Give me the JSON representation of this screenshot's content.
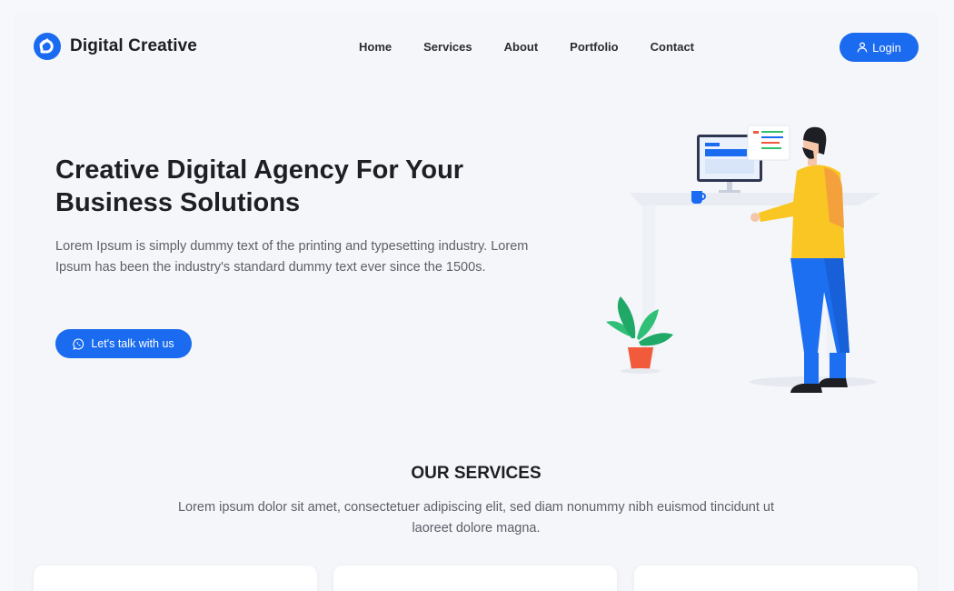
{
  "brand": {
    "name": "Digital Creative",
    "logo_icon": "d-logo-icon",
    "accent": "#1a6bf0"
  },
  "nav": {
    "items": [
      "Home",
      "Services",
      "About",
      "Portfolio",
      "Contact"
    ]
  },
  "header": {
    "login_label": "Login",
    "login_icon": "user-icon"
  },
  "hero": {
    "title": "Creative Digital Agency For Your Business Solutions",
    "text": "Lorem Ipsum is simply dummy text of the printing and typesetting industry. Lorem Ipsum has been the industry's standard dummy text ever since the 1500s.",
    "cta_label": "Let's talk with us",
    "cta_icon": "whatsapp-icon"
  },
  "services": {
    "title": "OUR SERVICES",
    "text": "Lorem ipsum dolor sit amet, consectetuer adipiscing elit, sed diam nonummy nibh euismod tincidunt ut laoreet dolore magna.",
    "cards": [
      {},
      {},
      {}
    ]
  }
}
